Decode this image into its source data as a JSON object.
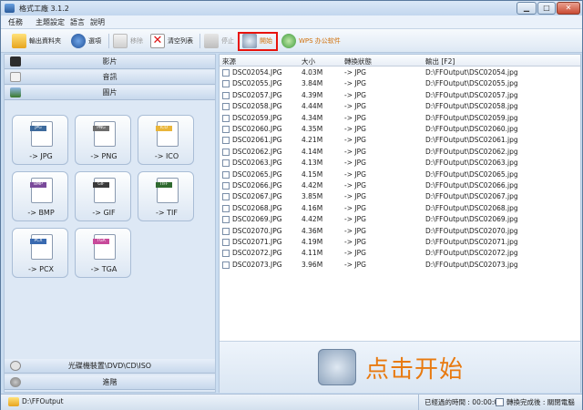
{
  "window": {
    "title": "格式工廠 3.1.2",
    "min_label": "▁",
    "max_label": "□",
    "close_label": "✕"
  },
  "menu": [
    "任務",
    "主題設定",
    "語言",
    "說明"
  ],
  "toolbar": {
    "output_folder": "輸出資料夾",
    "options": "選項",
    "remove": "移除",
    "clear_list": "清空列表",
    "stop": "停止",
    "start": "開始",
    "wps": "WPS 办公软件"
  },
  "left_panel": {
    "categories_top": [
      "影片",
      "音訊",
      "圖片"
    ],
    "formats": [
      "-> JPG",
      "-> PNG",
      "-> ICO",
      "-> BMP",
      "-> GIF",
      "-> TIF",
      "-> PCX",
      "-> TGA"
    ],
    "badges": [
      "JPG",
      "PNG",
      "ICO",
      "BMP",
      "GIF",
      "TIFF",
      "PCX",
      "TGA"
    ],
    "categories_bottom": [
      "光碟機裝置\\DVD\\CD\\ISO",
      "進階"
    ]
  },
  "table": {
    "headers": [
      "來源",
      "大小",
      "轉換狀態",
      "輸出 [F2]"
    ],
    "rows": [
      {
        "src": "DSC02054.JPG",
        "size": "4.03M",
        "status": "-> JPG",
        "out": "D:\\FFOutput\\DSC02054.jpg"
      },
      {
        "src": "DSC02055.JPG",
        "size": "3.84M",
        "status": "-> JPG",
        "out": "D:\\FFOutput\\DSC02055.jpg"
      },
      {
        "src": "DSC02057.JPG",
        "size": "4.39M",
        "status": "-> JPG",
        "out": "D:\\FFOutput\\DSC02057.jpg"
      },
      {
        "src": "DSC02058.JPG",
        "size": "4.44M",
        "status": "-> JPG",
        "out": "D:\\FFOutput\\DSC02058.jpg"
      },
      {
        "src": "DSC02059.JPG",
        "size": "4.34M",
        "status": "-> JPG",
        "out": "D:\\FFOutput\\DSC02059.jpg"
      },
      {
        "src": "DSC02060.JPG",
        "size": "4.35M",
        "status": "-> JPG",
        "out": "D:\\FFOutput\\DSC02060.jpg"
      },
      {
        "src": "DSC02061.JPG",
        "size": "4.21M",
        "status": "-> JPG",
        "out": "D:\\FFOutput\\DSC02061.jpg"
      },
      {
        "src": "DSC02062.JPG",
        "size": "4.14M",
        "status": "-> JPG",
        "out": "D:\\FFOutput\\DSC02062.jpg"
      },
      {
        "src": "DSC02063.JPG",
        "size": "4.13M",
        "status": "-> JPG",
        "out": "D:\\FFOutput\\DSC02063.jpg"
      },
      {
        "src": "DSC02065.JPG",
        "size": "4.15M",
        "status": "-> JPG",
        "out": "D:\\FFOutput\\DSC02065.jpg"
      },
      {
        "src": "DSC02066.JPG",
        "size": "4.42M",
        "status": "-> JPG",
        "out": "D:\\FFOutput\\DSC02066.jpg"
      },
      {
        "src": "DSC02067.JPG",
        "size": "3.85M",
        "status": "-> JPG",
        "out": "D:\\FFOutput\\DSC02067.jpg"
      },
      {
        "src": "DSC02068.JPG",
        "size": "4.16M",
        "status": "-> JPG",
        "out": "D:\\FFOutput\\DSC02068.jpg"
      },
      {
        "src": "DSC02069.JPG",
        "size": "4.42M",
        "status": "-> JPG",
        "out": "D:\\FFOutput\\DSC02069.jpg"
      },
      {
        "src": "DSC02070.JPG",
        "size": "4.36M",
        "status": "-> JPG",
        "out": "D:\\FFOutput\\DSC02070.jpg"
      },
      {
        "src": "DSC02071.JPG",
        "size": "4.19M",
        "status": "-> JPG",
        "out": "D:\\FFOutput\\DSC02071.jpg"
      },
      {
        "src": "DSC02072.JPG",
        "size": "4.11M",
        "status": "-> JPG",
        "out": "D:\\FFOutput\\DSC02072.jpg"
      },
      {
        "src": "DSC02073.JPG",
        "size": "3.96M",
        "status": "-> JPG",
        "out": "D:\\FFOutput\\DSC02073.jpg"
      }
    ]
  },
  "start_banner": "点击开始",
  "status": {
    "output_path": "D:\\FFOutput",
    "elapsed": "已經過的時間 : 00:00:00",
    "after_convert": "轉換完成後 : 關閉電腦"
  },
  "colors": {
    "highlight": "#e8130c",
    "start_text": "#e87a10",
    "accent": "#c9dcf0"
  }
}
